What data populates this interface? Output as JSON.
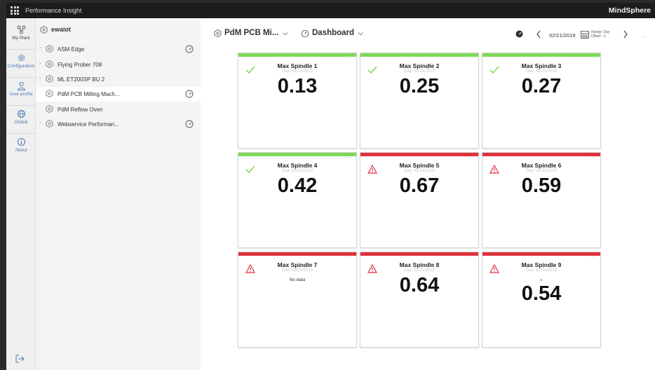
{
  "header": {
    "app_title": "Performance Insight",
    "brand": "MindSphere"
  },
  "nav": {
    "items": [
      {
        "label": "My Plant",
        "icon": "plant-icon"
      },
      {
        "label": "Configuration",
        "icon": "gear-icon"
      },
      {
        "label": "User profile",
        "icon": "user-icon"
      },
      {
        "label": "Global",
        "icon": "globe-icon"
      },
      {
        "label": "About",
        "icon": "info-icon"
      }
    ],
    "logout_icon": "logout-icon"
  },
  "tree": {
    "root": "ewaiot",
    "items": [
      {
        "label": "ASM Edge"
      },
      {
        "label": "Flying Prober 708"
      },
      {
        "label": "ML ET200SP BU 2"
      },
      {
        "label": "PdM PCB Milling Mach..."
      },
      {
        "label": "PdM Reflow Oven"
      },
      {
        "label": "Webservice Performan..."
      }
    ]
  },
  "toolbar": {
    "asset": "PdM PCB Mi...",
    "view": "Dashboard",
    "date": "02/21/2019",
    "range_line1": "Range: Day",
    "range_line2": "Offset: -1"
  },
  "status_colors": {
    "ok": "#7ed957",
    "alarm": "#e0323c"
  },
  "tiles": [
    {
      "title": "Max Spindle 1",
      "sub": "Day: 02/21/2019",
      "value": "0.13",
      "status": "ok"
    },
    {
      "title": "Max Spindle 2",
      "sub": "Day: 02/21/2019",
      "value": "0.25",
      "status": "ok"
    },
    {
      "title": "Max Spindle 3",
      "sub": "Day: 02/21/2019",
      "value": "0.27",
      "status": "ok"
    },
    {
      "title": "Max Spindle 4",
      "sub": "Day: 02/21/2019",
      "value": "0.42",
      "status": "ok"
    },
    {
      "title": "Max Spindle 5",
      "sub": "Day: 02/21/2019",
      "value": "0.67",
      "status": "alarm"
    },
    {
      "title": "Max Spindle 6",
      "sub": "Day: 02/21/2019",
      "value": "0.59",
      "status": "alarm"
    },
    {
      "title": "Max Spindle 7",
      "sub": "Day: 02/21/2019",
      "value": "",
      "nodata": "No data",
      "status": "alarm"
    },
    {
      "title": "Max Spindle 8",
      "sub": "Day: 02/21/2019",
      "value": "0.64",
      "status": "alarm"
    },
    {
      "title": "Max Spindle 9",
      "sub": "Day: 02/21/2019",
      "value": "0.54",
      "tiny": "x",
      "status": "alarm"
    }
  ]
}
